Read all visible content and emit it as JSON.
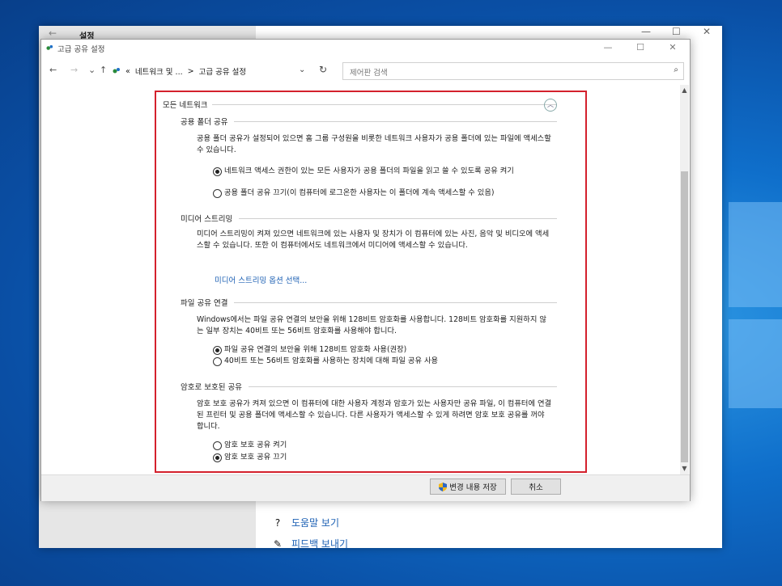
{
  "settings": {
    "title": "설정",
    "back_glyph": "←",
    "links": [
      {
        "icon": "help-icon",
        "glyph": "?",
        "label": "도움말 보기"
      },
      {
        "icon": "feedback-icon",
        "glyph": "✎",
        "label": "피드백 보내기"
      }
    ],
    "ctrl": {
      "min": "—",
      "max": "☐",
      "close": "✕"
    }
  },
  "window": {
    "title": "고급 공유 설정",
    "ctrl": {
      "min": "—",
      "max": "☐",
      "close": "✕"
    }
  },
  "nav": {
    "back": "←",
    "forward": "→",
    "recent": "⌄",
    "up": "↑",
    "address": {
      "prefix": "«",
      "crumb1": "네트워크 및 ...",
      "sep": ">",
      "crumb2": "고급 공유 설정"
    },
    "dropdown": "⌄",
    "refresh": "↻",
    "search_placeholder": "제어판 검색",
    "search_icon": "⌕"
  },
  "content": {
    "section_title": "모든 네트워크",
    "collapse_glyph": "︿",
    "public_folder": {
      "heading": "공용 폴더 공유",
      "desc": "공용 폴더 공유가 설정되어 있으면 홈 그룹 구성원을 비롯한 네트워크 사용자가 공용 폴더에 있는 파일에 액세스할 수 있습니다.",
      "options": [
        {
          "label": "네트워크 액세스 권한이 있는 모든 사용자가 공용 폴더의 파일을 읽고 쓸 수 있도록 공유 켜기",
          "selected": true
        },
        {
          "label": "공용 폴더 공유 끄기(이 컴퓨터에 로그온한 사용자는 이 폴더에 계속 액세스할 수 있음)",
          "selected": false
        }
      ]
    },
    "media": {
      "heading": "미디어 스트리밍",
      "desc": "미디어 스트리밍이 켜져 있으면 네트워크에 있는 사용자 및 장치가 이 컴퓨터에 있는 사진, 음악 및 비디오에 액세스할 수 있습니다. 또한 이 컴퓨터에서도 네트워크에서 미디어에 액세스할 수 있습니다.",
      "link": "미디어 스트리밍 옵션 선택..."
    },
    "file_sharing": {
      "heading": "파일 공유 연결",
      "desc": "Windows에서는 파일 공유 연결의 보안을 위해 128비트 암호화를 사용합니다. 128비트 암호화를 지원하지 않는 일부 장치는 40비트 또는 56비트 암호화를 사용해야 합니다.",
      "options": [
        {
          "label": "파일 공유 연결의 보안을 위해 128비트 암호화 사용(권장)",
          "selected": true
        },
        {
          "label": "40비트 또는 56비트 암호화를 사용하는 장치에 대해 파일 공유 사용",
          "selected": false
        }
      ]
    },
    "password": {
      "heading": "암호로 보호된 공유",
      "desc": "암호 보호 공유가 켜져 있으면 이 컴퓨터에 대한 사용자 계정과 암호가 있는 사용자만 공유 파일, 이 컴퓨터에 연결된 프린터 및 공용 폴더에 액세스할 수 있습니다. 다른 사용자가 액세스할 수 있게 하려면 암호 보호 공유를 꺼야 합니다.",
      "options": [
        {
          "label": "암호 보호 공유 켜기",
          "selected": false
        },
        {
          "label": "암호 보호 공유 끄기",
          "selected": true
        }
      ]
    }
  },
  "footer": {
    "save": "변경 내용 저장",
    "cancel": "취소"
  },
  "scroll": {
    "up": "▲",
    "down": "▼"
  },
  "colors": {
    "highlight": "#d4212d",
    "link": "#1b5fb3",
    "desktop": "#0f6fcb"
  }
}
